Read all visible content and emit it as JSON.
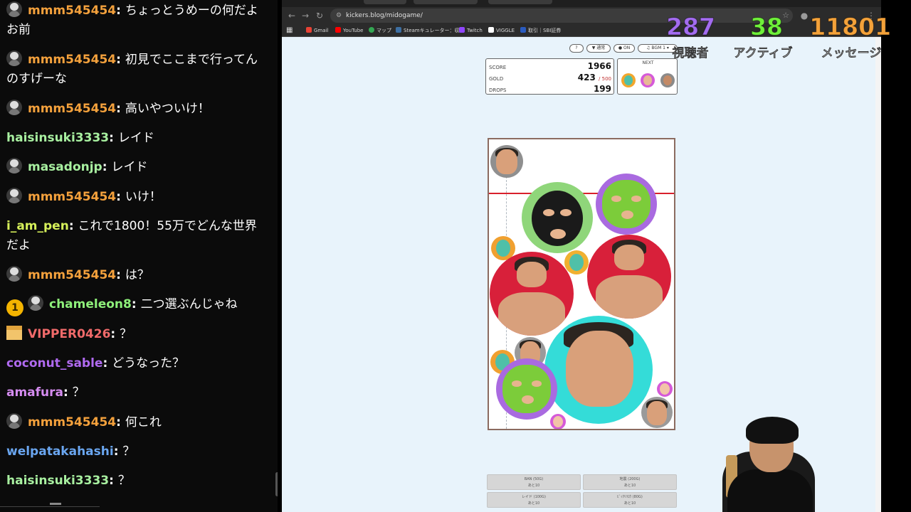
{
  "chat": {
    "messages": [
      {
        "user": "mmm545454",
        "text": "ちょっとうめーの何だよ",
        "cont": "お前",
        "color": "#f4a13c",
        "avatar": true
      },
      {
        "user": "mmm545454",
        "text": "初見でここまで行ってん",
        "cont": "のすげーな",
        "color": "#f4a13c",
        "avatar": true
      },
      {
        "user": "mmm545454",
        "text": "高いやついけ！",
        "color": "#f4a13c",
        "avatar": true
      },
      {
        "user": "haisinsuki3333",
        "text": "レイド",
        "color": "#a8f0a0",
        "avatar": false
      },
      {
        "user": "masadonjp",
        "text": "レイド",
        "color": "#a8f0a0",
        "avatar": true
      },
      {
        "user": "mmm545454",
        "text": "いけ！",
        "color": "#f4a13c",
        "avatar": true
      },
      {
        "user": "i_am_pen",
        "text": "これで1800！55万でどんな世界",
        "cont": "だよ",
        "color": "#d6f05a",
        "avatar": false
      },
      {
        "user": "mmm545454",
        "text": "は？",
        "color": "#f4a13c",
        "avatar": true
      },
      {
        "user": "chameleon8",
        "text": "二つ選ぶんじゃね",
        "color": "#8ef07a",
        "avatar": true,
        "badge": "1"
      },
      {
        "user": "VIPPER0426",
        "text": "？",
        "color": "#f06a6a",
        "gift": true
      },
      {
        "user": "coconut_sable",
        "text": "どうなった？",
        "color": "#b06af0",
        "avatar": false
      },
      {
        "user": "amafura",
        "text": "？",
        "color": "#d58cf0",
        "avatar": false
      },
      {
        "user": "mmm545454",
        "text": "何これ",
        "color": "#f4a13c",
        "avatar": true
      },
      {
        "user": "welpatakahashi",
        "text": "？",
        "color": "#6aa6f0",
        "avatar": false
      },
      {
        "user": "haisinsuki3333",
        "text": "？",
        "color": "#a8f0a0",
        "avatar": false
      }
    ]
  },
  "browser": {
    "url": "kickers.blog/midogame/",
    "bookmarks": [
      "Gmail",
      "YouTube",
      "マップ",
      "Steamキュレーター：収...",
      "Twitch",
      "VIGGLE",
      "取引｜SBI証券"
    ]
  },
  "game": {
    "controls": {
      "help": "?",
      "speed": "通常",
      "sound": "ON",
      "bgm": "BGM 1"
    },
    "score_label": "SCORE",
    "score": "1966",
    "gold_label": "GOLD",
    "gold": "423",
    "gold_max": "/ 500",
    "drops_label": "DROPS",
    "drops": "199",
    "next_label": "NEXT",
    "buttons": [
      {
        "line1": "BAN (50G)",
        "line2": "あと10"
      },
      {
        "line1": "地震 (200G)",
        "line2": "あと10"
      },
      {
        "line1": "レイド (100G)",
        "line2": "あと10"
      },
      {
        "line1": "ﾋﾞｯｸﾘﾘﾛｳ (80G)",
        "line2": "あと10"
      }
    ]
  },
  "overlay": {
    "viewers": "287",
    "viewers_label": "視聴者",
    "active": "38",
    "active_label": "アクティブ",
    "messages": "11801",
    "messages_label": "メッセージ",
    "colors": {
      "viewers": "#a36cf0",
      "active": "#6ff03a",
      "messages": "#f4a23a"
    }
  }
}
